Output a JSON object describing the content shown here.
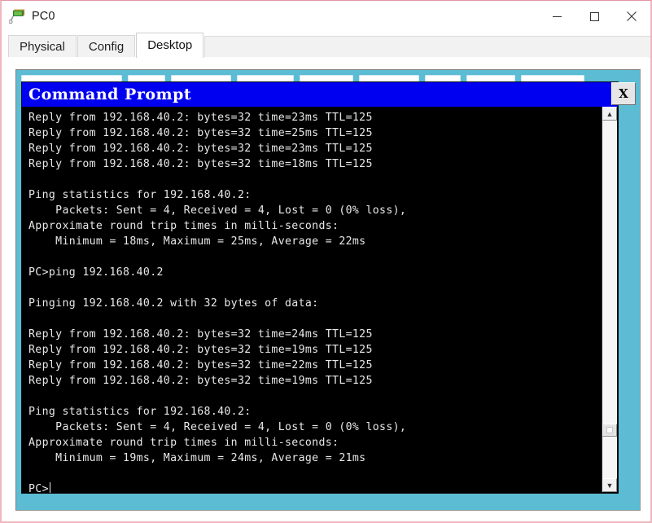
{
  "window": {
    "title": "PC0",
    "icon": "pc-device-icon",
    "controls": {
      "minimize": "minimize-icon",
      "maximize": "maximize-icon",
      "close": "close-icon"
    }
  },
  "tabs": [
    {
      "label": "Physical",
      "active": false
    },
    {
      "label": "Config",
      "active": false
    },
    {
      "label": "Desktop",
      "active": true
    }
  ],
  "desktop": {
    "background_color": "#5bbcd4",
    "app_chips": 9
  },
  "command_prompt": {
    "title": "Command Prompt",
    "titlebar_color": "#0000f0",
    "close_label": "X",
    "background_color": "#000000",
    "text_color": "#e8e8e8",
    "scrollbar": {
      "up_arrow": "chevron-up-icon",
      "down_arrow": "chevron-down-icon",
      "thumb_position_percent": 88
    },
    "lines": [
      "Reply from 192.168.40.2: bytes=32 time=23ms TTL=125",
      "Reply from 192.168.40.2: bytes=32 time=25ms TTL=125",
      "Reply from 192.168.40.2: bytes=32 time=23ms TTL=125",
      "Reply from 192.168.40.2: bytes=32 time=18ms TTL=125",
      "",
      "Ping statistics for 192.168.40.2:",
      "    Packets: Sent = 4, Received = 4, Lost = 0 (0% loss),",
      "Approximate round trip times in milli-seconds:",
      "    Minimum = 18ms, Maximum = 25ms, Average = 22ms",
      "",
      "PC>ping 192.168.40.2",
      "",
      "Pinging 192.168.40.2 with 32 bytes of data:",
      "",
      "Reply from 192.168.40.2: bytes=32 time=24ms TTL=125",
      "Reply from 192.168.40.2: bytes=32 time=19ms TTL=125",
      "Reply from 192.168.40.2: bytes=32 time=22ms TTL=125",
      "Reply from 192.168.40.2: bytes=32 time=19ms TTL=125",
      "",
      "Ping statistics for 192.168.40.2:",
      "    Packets: Sent = 4, Received = 4, Lost = 0 (0% loss),",
      "Approximate round trip times in milli-seconds:",
      "    Minimum = 19ms, Maximum = 24ms, Average = 21ms",
      ""
    ],
    "prompt": "PC>"
  }
}
